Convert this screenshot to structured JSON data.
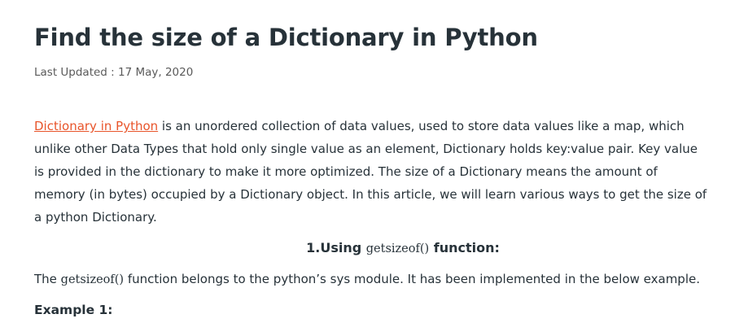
{
  "article": {
    "title": "Find the size of a Dictionary in Python",
    "last_updated": "Last Updated : 17 May, 2020",
    "intro": {
      "link_text": "Dictionary in Python",
      "text": " is an unordered collection of data values, used to store data values like a map, which unlike other Data Types that hold only single value as an element, Dictionary holds key:value pair. Key value is provided in the dictionary to make it more optimized. The size of a Dictionary means the amount of memory (in bytes) occupied by a Dictionary object. In this article, we will learn various ways to get the size of a python Dictionary."
    },
    "section": {
      "prefix": "1.Using ",
      "code": "getsizeof()",
      "suffix": " function:"
    },
    "description": {
      "prefix": "The ",
      "code": "getsizeof()",
      "suffix": " function belongs to the python’s sys module. It has been implemented in the below example."
    },
    "example_label": "Example 1:"
  }
}
